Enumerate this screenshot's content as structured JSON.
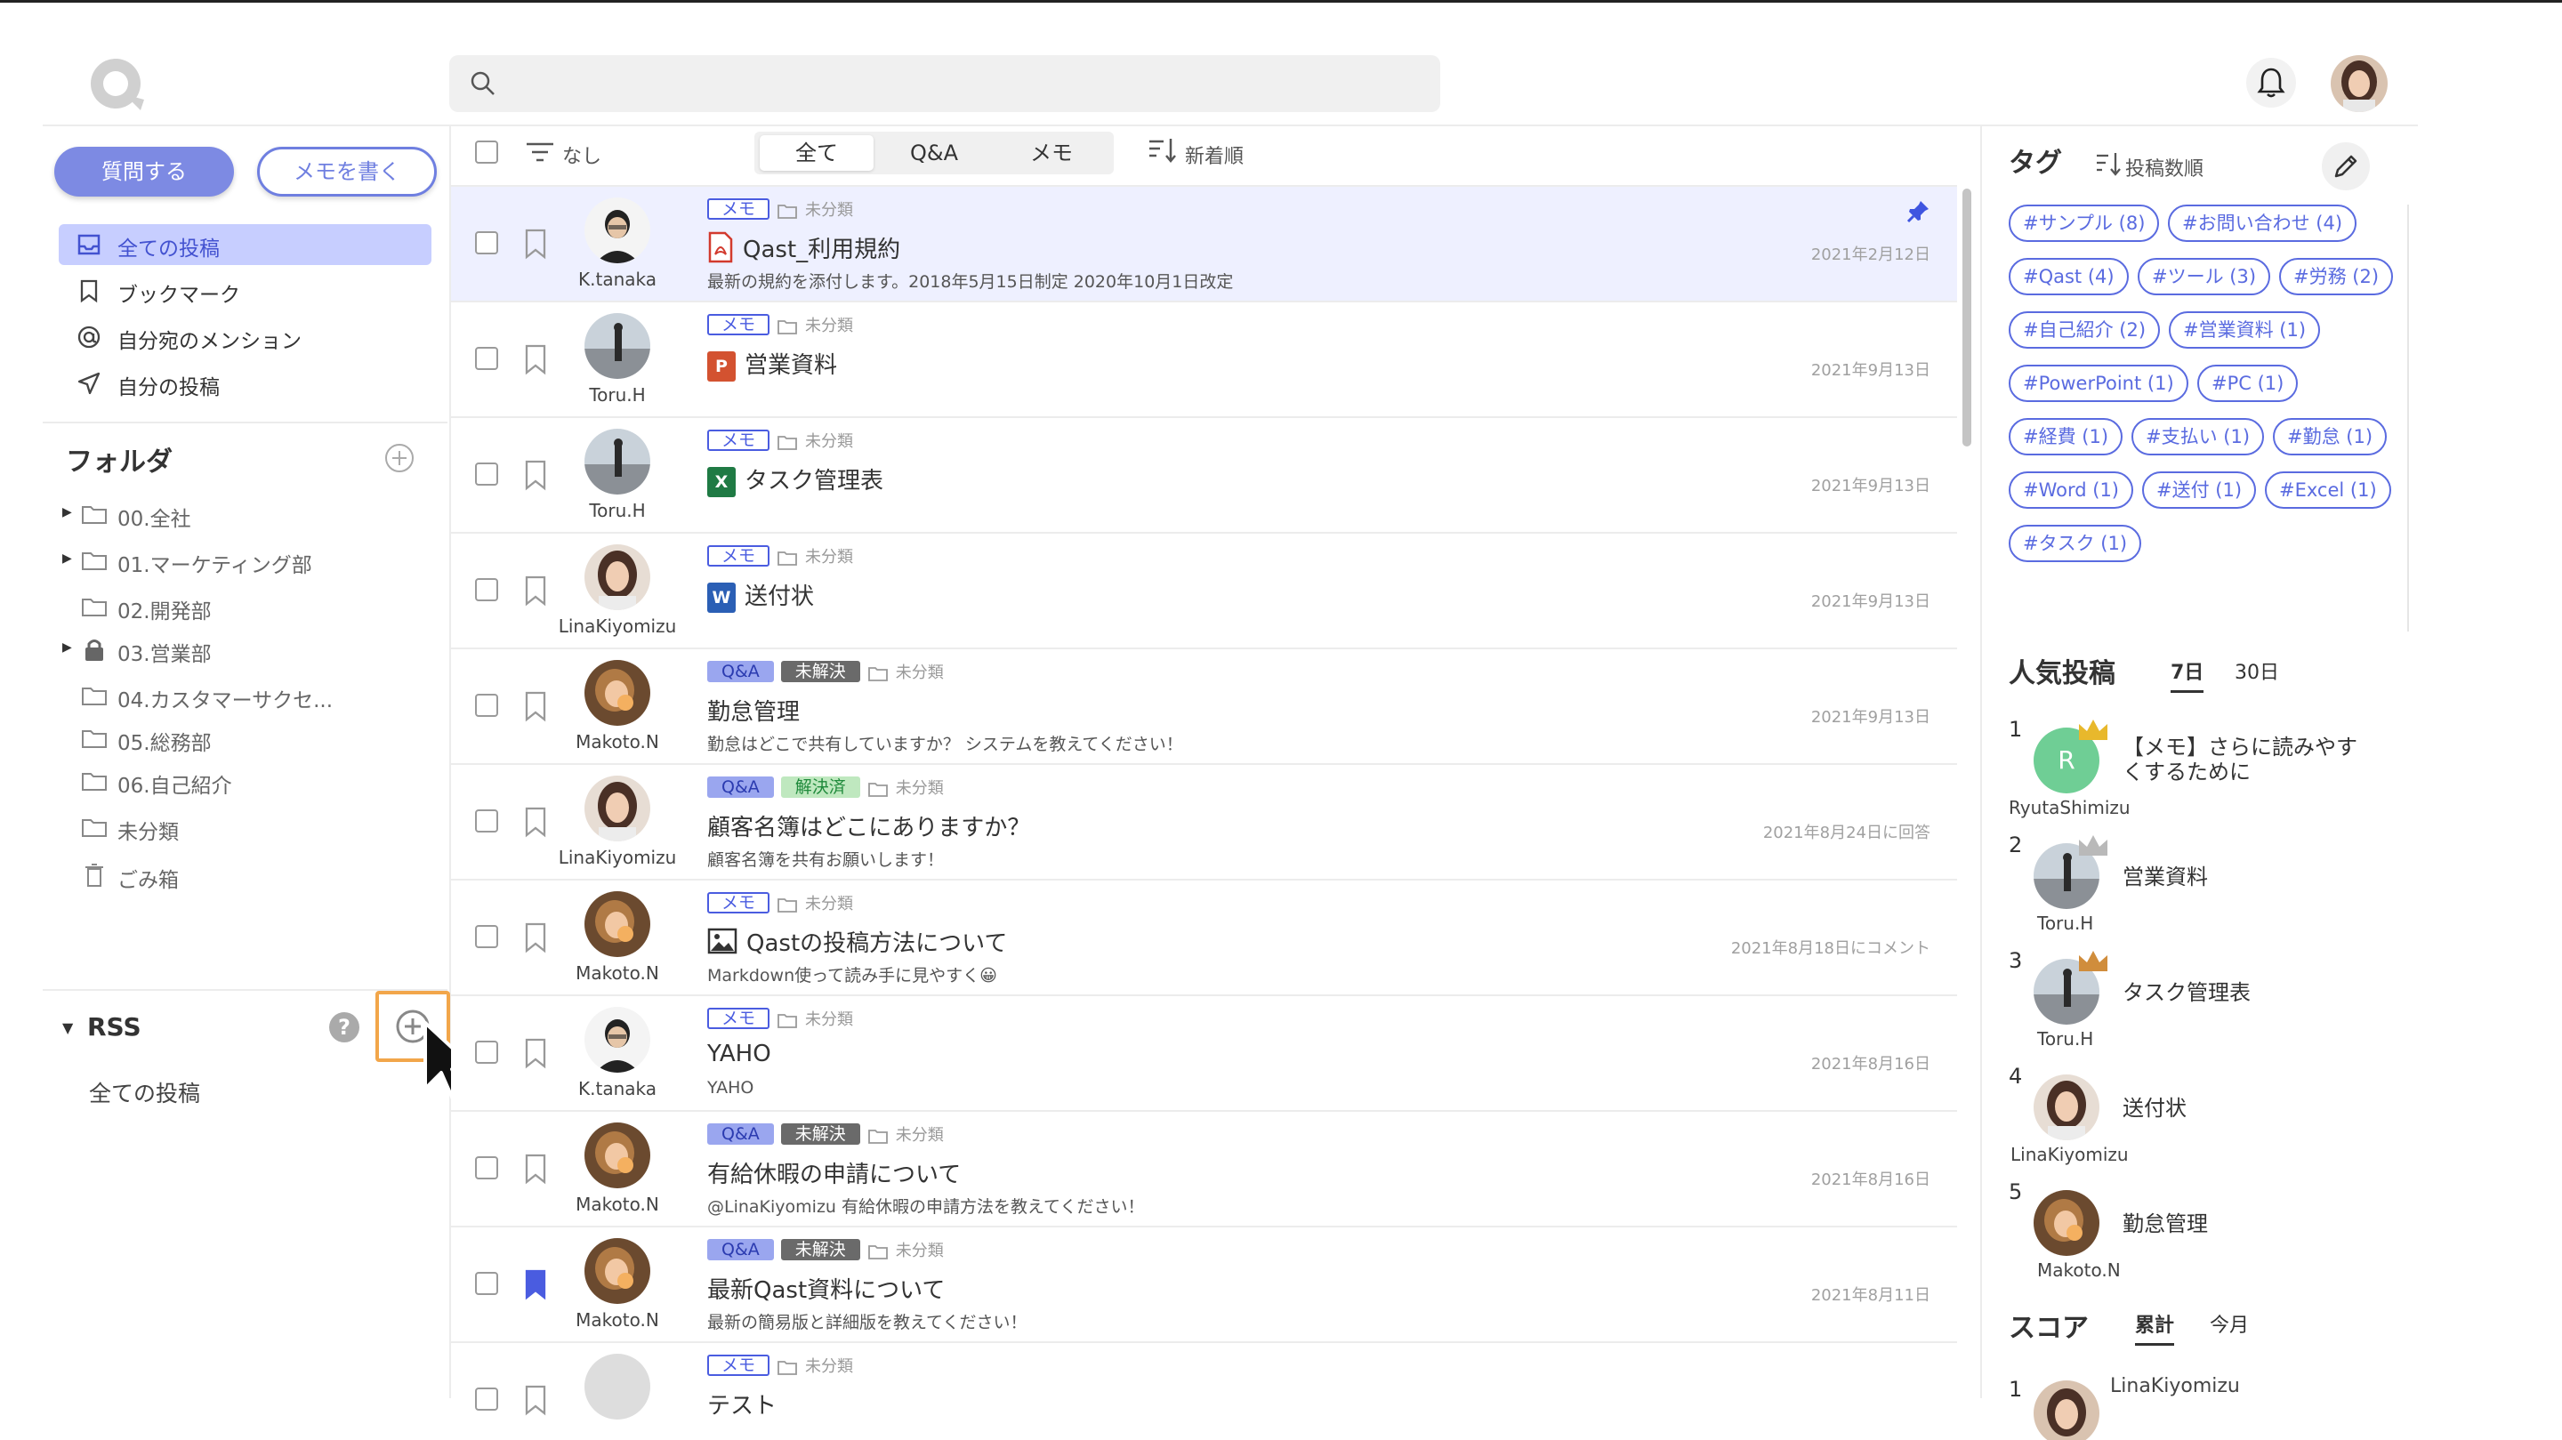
{
  "header": {
    "search_placeholder": ""
  },
  "sidebar": {
    "ask_button": "質問する",
    "memo_button": "メモを書く",
    "nav": [
      {
        "label": "全ての投稿"
      },
      {
        "label": "ブックマーク"
      },
      {
        "label": "自分宛のメンション"
      },
      {
        "label": "自分の投稿"
      }
    ],
    "folders_title": "フォルダ",
    "folders": [
      {
        "label": "00.全社"
      },
      {
        "label": "01.マーケティング部"
      },
      {
        "label": "02.開発部"
      },
      {
        "label": "03.営業部"
      },
      {
        "label": "04.カスタマーサクセ..."
      },
      {
        "label": "05.総務部"
      },
      {
        "label": "06.自己紹介"
      },
      {
        "label": "未分類"
      },
      {
        "label": "ごみ箱"
      }
    ],
    "rss_title": "RSS",
    "rss_help": "?",
    "rss_items": [
      {
        "label": "全ての投稿"
      }
    ]
  },
  "toolbar": {
    "filter_label": "なし",
    "segments": [
      "全て",
      "Q&A",
      "メモ"
    ],
    "sort_label": "新着順"
  },
  "posts": [
    {
      "type": "メモ",
      "status": "",
      "folder": "未分類",
      "title": "Qast_利用規約",
      "file": "pdf",
      "desc": "最新の規約を添付します。2018年5月15日制定 2020年10月1日改定",
      "date": "2021年2月12日",
      "author": "K.tanaka",
      "pinned": true
    },
    {
      "type": "メモ",
      "status": "",
      "folder": "未分類",
      "title": "営業資料",
      "file": "ppt",
      "desc": "",
      "date": "2021年9月13日",
      "author": "Toru.H"
    },
    {
      "type": "メモ",
      "status": "",
      "folder": "未分類",
      "title": "タスク管理表",
      "file": "xls",
      "desc": "",
      "date": "2021年9月13日",
      "author": "Toru.H"
    },
    {
      "type": "メモ",
      "status": "",
      "folder": "未分類",
      "title": "送付状",
      "file": "doc",
      "desc": "",
      "date": "2021年9月13日",
      "author": "LinaKiyomizu"
    },
    {
      "type": "Q&A",
      "status": "未解決",
      "folder": "未分類",
      "title": "勤怠管理",
      "file": "",
      "desc": "勤怠はどこで共有していますか？ システムを教えてください！",
      "date": "2021年9月13日",
      "author": "Makoto.N"
    },
    {
      "type": "Q&A",
      "status": "解決済",
      "folder": "未分類",
      "title": "顧客名簿はどこにありますか？",
      "file": "",
      "desc": "顧客名簿を共有お願いします！",
      "date": "2021年8月24日に回答",
      "author": "LinaKiyomizu"
    },
    {
      "type": "メモ",
      "status": "",
      "folder": "未分類",
      "title": "Qastの投稿方法について",
      "file": "img",
      "desc": "Markdown使って読み手に見やすく😀",
      "date": "2021年8月18日にコメント",
      "author": "Makoto.N"
    },
    {
      "type": "メモ",
      "status": "",
      "folder": "未分類",
      "title": "YAHO",
      "file": "",
      "desc": "YAHO",
      "date": "2021年8月16日",
      "author": "K.tanaka"
    },
    {
      "type": "Q&A",
      "status": "未解決",
      "folder": "未分類",
      "title": "有給休暇の申請について",
      "file": "",
      "desc": "@LinaKiyomizu 有給休暇の申請方法を教えてください！",
      "date": "2021年8月16日",
      "author": "Makoto.N"
    },
    {
      "type": "Q&A",
      "status": "未解決",
      "folder": "未分類",
      "title": "最新Qast資料について",
      "file": "",
      "desc": "最新の簡易版と詳細版を教えてください！",
      "date": "2021年8月11日",
      "author": "Makoto.N",
      "bookmarked": true
    },
    {
      "type": "メモ",
      "status": "",
      "folder": "未分類",
      "title": "テスト",
      "file": "",
      "desc": "",
      "date": "",
      "author": ""
    }
  ],
  "right": {
    "tags_title": "タグ",
    "tags_sort": "投稿数順",
    "tags": [
      "#サンプル (8)",
      "#お問い合わせ (4)",
      "#Qast (4)",
      "#ツール (3)",
      "#労務 (2)",
      "#自己紹介 (2)",
      "#営業資料 (1)",
      "#PowerPoint (1)",
      "#PC (1)",
      "#経費 (1)",
      "#支払い (1)",
      "#勤怠 (1)",
      "#Word (1)",
      "#送付 (1)",
      "#Excel (1)",
      "#タスク (1)"
    ],
    "popular_title": "人気投稿",
    "popular_tabs": [
      "7日",
      "30日"
    ],
    "popular": [
      {
        "rank": "1",
        "title": "【メモ】さらに読みやすくするために",
        "name": "RyutaShimizu",
        "initial": "R"
      },
      {
        "rank": "2",
        "title": "営業資料",
        "name": "Toru.H"
      },
      {
        "rank": "3",
        "title": "タスク管理表",
        "name": "Toru.H"
      },
      {
        "rank": "4",
        "title": "送付状",
        "name": "LinaKiyomizu"
      },
      {
        "rank": "5",
        "title": "勤怠管理",
        "name": "Makoto.N"
      }
    ],
    "score_title": "スコア",
    "score_tabs": [
      "累計",
      "今月"
    ],
    "score_first": {
      "rank": "1",
      "name": "LinaKiyomizu"
    }
  },
  "colors": {
    "accent": "#7d8ae3",
    "accent_dark": "#4a5ce0",
    "active_nav_bg": "#c7ceff",
    "selected_row_bg": "#eef0ff",
    "highlight_box": "#f2a64a"
  }
}
